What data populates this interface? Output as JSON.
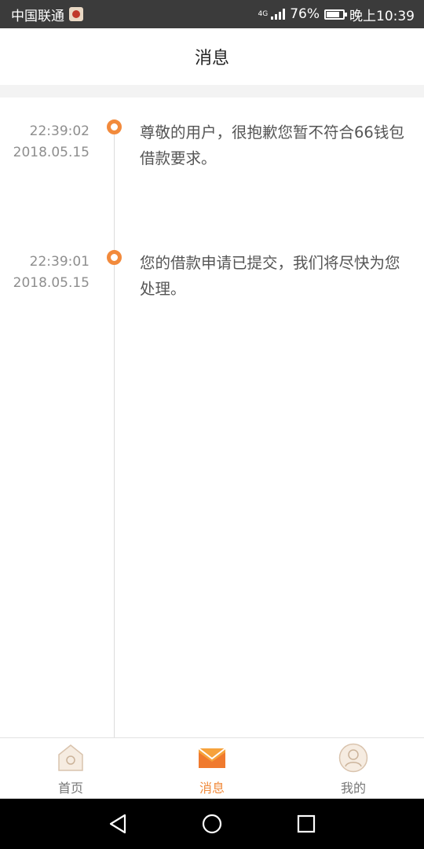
{
  "status_bar": {
    "carrier": "中国联通",
    "network": "4G",
    "battery": "76%",
    "time": "晚上10:39"
  },
  "header": {
    "title": "消息"
  },
  "messages": [
    {
      "time": "22:39:02",
      "date": "2018.05.15",
      "text": "尊敬的用户，很抱歉您暂不符合66钱包借款要求。"
    },
    {
      "time": "22:39:01",
      "date": "2018.05.15",
      "text": "您的借款申请已提交，我们将尽快为您处理。"
    }
  ],
  "tabbar": {
    "items": [
      {
        "label": "首页",
        "icon": "home-icon",
        "active": false
      },
      {
        "label": "消息",
        "icon": "mail-icon",
        "active": true
      },
      {
        "label": "我的",
        "icon": "user-icon",
        "active": false
      }
    ],
    "active_color": "#f08a3b"
  },
  "accent_color": "#f28a3c"
}
